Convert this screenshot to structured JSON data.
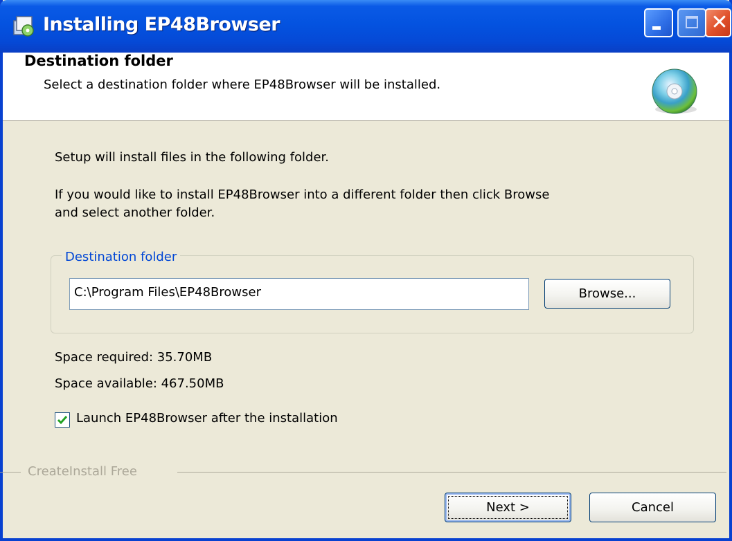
{
  "window": {
    "title": "Installing EP48Browser",
    "titlebar_color": "#0453e0",
    "icons": [
      "app-installer-icon",
      "minimize-icon",
      "maximize-icon",
      "close-icon"
    ]
  },
  "header": {
    "title": "Destination folder",
    "subtitle": "Select a destination folder where EP48Browser will be installed.",
    "icon": "cd-disc-icon"
  },
  "body": {
    "intro": "Setup will install files in the following folder.",
    "instructions_line1": "If you would like to install EP48Browser into a different folder then click Browse",
    "instructions_line2": "and select another folder."
  },
  "destination": {
    "group_label": "Destination folder",
    "path_value": "C:\\Program Files\\EP48Browser",
    "browse_label": "Browse..."
  },
  "space": {
    "required": "Space required: 35.70MB",
    "available": "Space available: 467.50MB"
  },
  "launch_option": {
    "label": "Launch EP48Browser after the installation",
    "checked": true
  },
  "footer": {
    "brand": "CreateInstall Free",
    "next_label": "Next >",
    "cancel_label": "Cancel"
  }
}
